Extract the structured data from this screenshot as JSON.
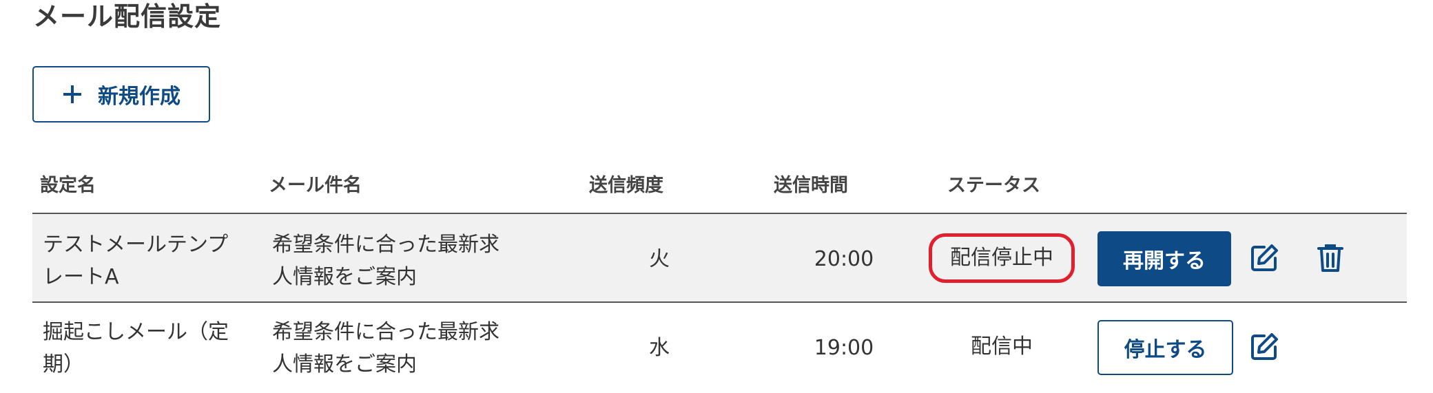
{
  "page": {
    "title": "メール配信設定"
  },
  "toolbar": {
    "new_label": "新規作成"
  },
  "table": {
    "headers": {
      "name": "設定名",
      "subject": "メール件名",
      "frequency": "送信頻度",
      "time": "送信時間",
      "status": "ステータス"
    },
    "rows": [
      {
        "name_line1": "テストメールテンプ",
        "name_line2": "レートA",
        "subject_line1": "希望条件に合った最新求",
        "subject_line2": "人情報をご案内",
        "frequency": "火",
        "time": "20:00",
        "status": "配信停止中",
        "action_label": "再開する"
      },
      {
        "name_line1": "掘起こしメール（定",
        "name_line2": "期）",
        "subject_line1": "希望条件に合った最新求",
        "subject_line2": "人情報をご案内",
        "frequency": "水",
        "time": "19:00",
        "status": "配信中",
        "action_label": "停止する"
      }
    ]
  },
  "icons": {
    "new": "plus-icon",
    "edit": "edit-icon",
    "delete": "trash-icon"
  },
  "colors": {
    "primary": "#0d4a86",
    "highlight": "#e0202e",
    "row_bg": "#f1f1f1"
  }
}
